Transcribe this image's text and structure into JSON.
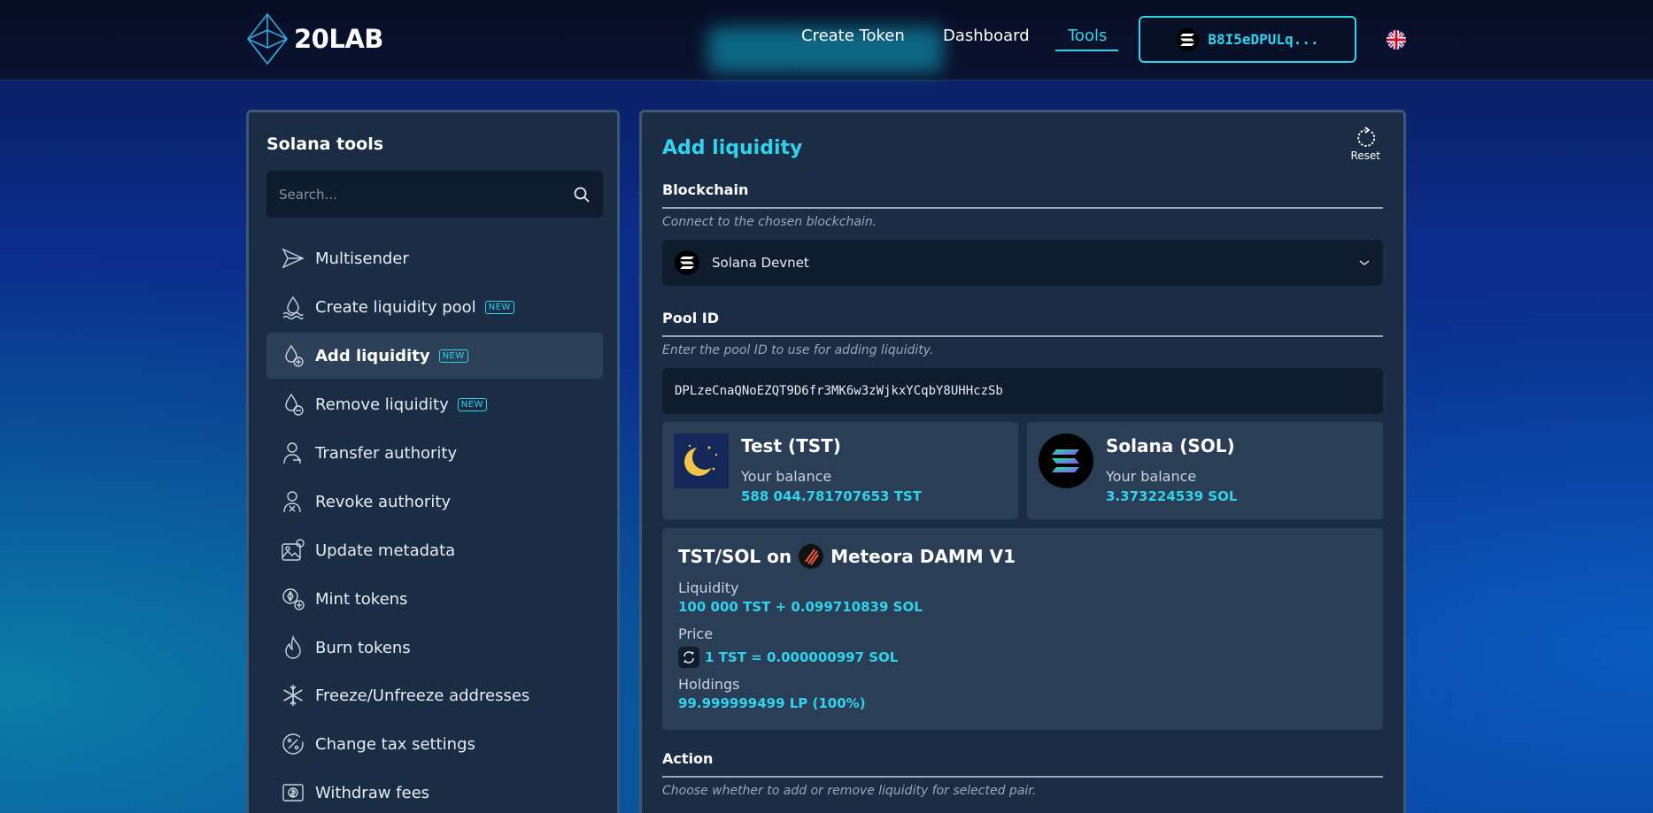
{
  "header": {
    "logo_text": "20LAB",
    "nav": [
      {
        "label": "Create Token"
      },
      {
        "label": "Dashboard"
      },
      {
        "label": "Tools",
        "active": true
      }
    ],
    "wallet_label": "B8I5eDPULq...",
    "language": "en-GB"
  },
  "sidebar": {
    "title": "Solana tools",
    "search_placeholder": "Search...",
    "new_badge": "NEW",
    "items": [
      {
        "label": "Multisender",
        "icon": "send-icon"
      },
      {
        "label": "Create liquidity pool",
        "icon": "water-drop-icon",
        "badge": true
      },
      {
        "label": "Add liquidity",
        "icon": "drop-plus-icon",
        "badge": true,
        "active": true
      },
      {
        "label": "Remove liquidity",
        "icon": "drop-minus-icon",
        "badge": true
      },
      {
        "label": "Transfer authority",
        "icon": "user-transfer-icon"
      },
      {
        "label": "Revoke authority",
        "icon": "user-revoke-icon"
      },
      {
        "label": "Update metadata",
        "icon": "image-edit-icon"
      },
      {
        "label": "Mint tokens",
        "icon": "mint-icon"
      },
      {
        "label": "Burn tokens",
        "icon": "flame-icon"
      },
      {
        "label": "Freeze/Unfreeze addresses",
        "icon": "snowflake-icon"
      },
      {
        "label": "Change tax settings",
        "icon": "percent-icon"
      },
      {
        "label": "Withdraw fees",
        "icon": "dollar-bill-icon"
      }
    ]
  },
  "main": {
    "title": "Add liquidity",
    "reset_label": "Reset",
    "blockchain": {
      "label": "Blockchain",
      "description": "Connect to the chosen blockchain.",
      "selected": "Solana Devnet"
    },
    "pool_id": {
      "label": "Pool ID",
      "description": "Enter the pool ID to use for adding liquidity.",
      "value": "DPLzeCnaQNoEZQT9D6fr3MK6w3zWjkxYCqbY8UHHczSb"
    },
    "tokens": [
      {
        "name": "Test (TST)",
        "balance_label": "Your balance",
        "balance": "588 044.781707653 TST"
      },
      {
        "name": "Solana (SOL)",
        "balance_label": "Your balance",
        "balance": "3.373224539 SOL"
      }
    ],
    "pool": {
      "pair": "TST/SOL on",
      "dex": "Meteora DAMM V1",
      "liquidity_label": "Liquidity",
      "liquidity": "100 000 TST + 0.099710839 SOL",
      "price_label": "Price",
      "price": "1 TST = 0.000000997 SOL",
      "holdings_label": "Holdings",
      "holdings": "99.999999499 LP (100%)"
    },
    "action": {
      "label": "Action",
      "description": "Choose whether to add or remove liquidity for selected pair."
    }
  },
  "colors": {
    "accent": "#2fd3ee",
    "panel": "#1b2d44",
    "card": "#2a3e55"
  }
}
